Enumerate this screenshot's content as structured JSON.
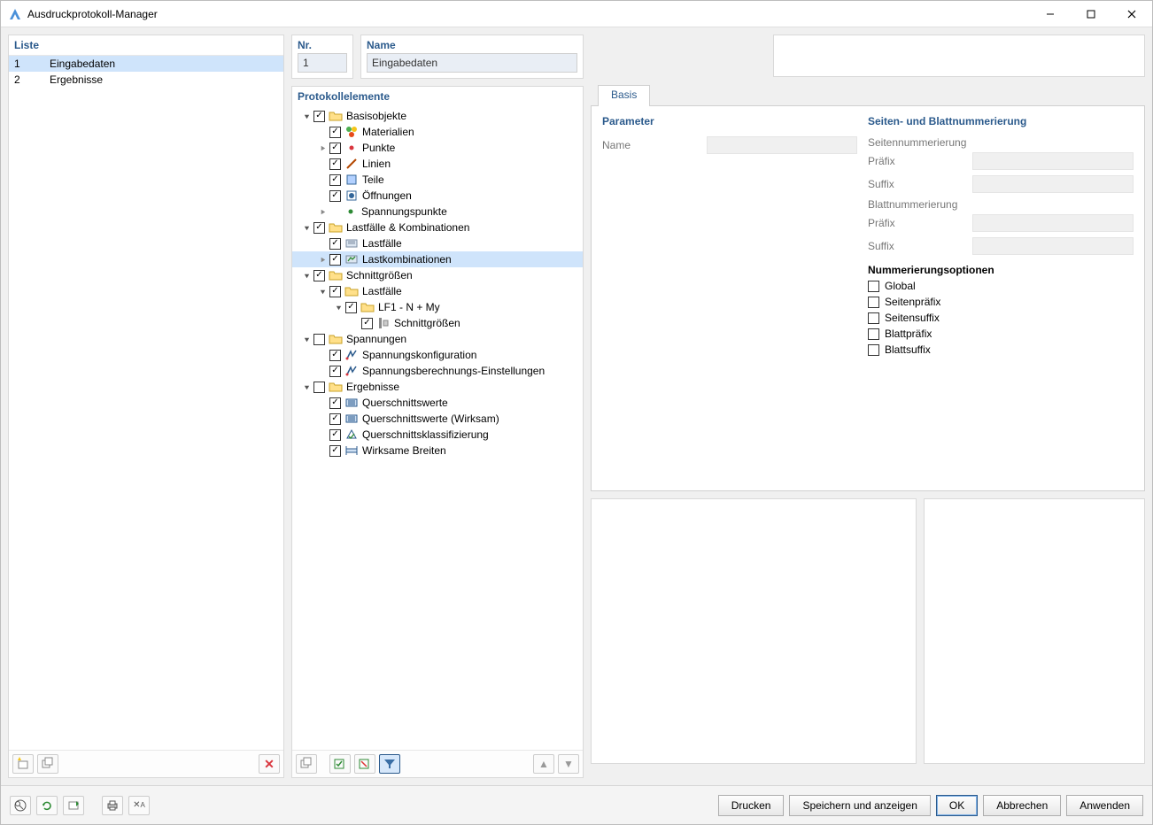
{
  "window": {
    "title": "Ausdruckprotokoll-Manager"
  },
  "left": {
    "header": "Liste",
    "rows": [
      {
        "n": "1",
        "name": "Eingabedaten",
        "selected": true
      },
      {
        "n": "2",
        "name": "Ergebnisse",
        "selected": false
      }
    ]
  },
  "mid": {
    "nr_label": "Nr.",
    "nr_value": "1",
    "name_label": "Name",
    "name_value": "Eingabedaten",
    "tree_header": "Protokollelemente",
    "tree": [
      {
        "lvl": 0,
        "expand": "open",
        "check": true,
        "icon": "folder",
        "label": "Basisobjekte"
      },
      {
        "lvl": 1,
        "expand": "none",
        "check": true,
        "icon": "materials",
        "label": "Materialien"
      },
      {
        "lvl": 1,
        "expand": "closed",
        "check": true,
        "icon": "dot-red",
        "label": "Punkte"
      },
      {
        "lvl": 1,
        "expand": "none",
        "check": true,
        "icon": "line",
        "label": "Linien"
      },
      {
        "lvl": 1,
        "expand": "none",
        "check": true,
        "icon": "part",
        "label": "Teile"
      },
      {
        "lvl": 1,
        "expand": "none",
        "check": true,
        "icon": "opening",
        "label": "Öffnungen"
      },
      {
        "lvl": 1,
        "expand": "closed",
        "check": null,
        "icon": "dot-green",
        "label": "Spannungspunkte"
      },
      {
        "lvl": 0,
        "expand": "open",
        "check": true,
        "icon": "folder",
        "label": "Lastfälle & Kombinationen"
      },
      {
        "lvl": 1,
        "expand": "none",
        "check": true,
        "icon": "lc",
        "label": "Lastfälle"
      },
      {
        "lvl": 1,
        "expand": "closed",
        "check": true,
        "icon": "lk",
        "label": "Lastkombinationen",
        "selected": true
      },
      {
        "lvl": 0,
        "expand": "open",
        "check": true,
        "icon": "folder",
        "label": "Schnittgrößen"
      },
      {
        "lvl": 1,
        "expand": "open",
        "check": true,
        "icon": "folder",
        "label": "Lastfälle"
      },
      {
        "lvl": 2,
        "expand": "open",
        "check": true,
        "icon": "folder",
        "label": "LF1 - N + My"
      },
      {
        "lvl": 3,
        "expand": "none",
        "check": true,
        "icon": "sg",
        "label": "Schnittgrößen"
      },
      {
        "lvl": 0,
        "expand": "open",
        "check": false,
        "icon": "folder",
        "label": "Spannungen"
      },
      {
        "lvl": 1,
        "expand": "none",
        "check": true,
        "icon": "sp",
        "label": "Spannungskonfiguration"
      },
      {
        "lvl": 1,
        "expand": "none",
        "check": true,
        "icon": "sp",
        "label": "Spannungsberechnungs-Einstellungen"
      },
      {
        "lvl": 0,
        "expand": "open",
        "check": false,
        "icon": "folder",
        "label": "Ergebnisse"
      },
      {
        "lvl": 1,
        "expand": "none",
        "check": true,
        "icon": "qs",
        "label": "Querschnittswerte"
      },
      {
        "lvl": 1,
        "expand": "none",
        "check": true,
        "icon": "qs",
        "label": "Querschnittswerte (Wirksam)"
      },
      {
        "lvl": 1,
        "expand": "none",
        "check": true,
        "icon": "qk",
        "label": "Querschnittsklassifizierung"
      },
      {
        "lvl": 1,
        "expand": "none",
        "check": true,
        "icon": "wb",
        "label": "Wirksame Breiten"
      }
    ]
  },
  "right": {
    "tab_basis": "Basis",
    "param_title": "Parameter",
    "param_name_label": "Name",
    "page_title": "Seiten- und Blattnummerierung",
    "seitennum": "Seitennummerierung",
    "blattnum": "Blattnummerierung",
    "prefix": "Präfix",
    "suffix": "Suffix",
    "opts_title": "Nummerierungsoptionen",
    "opts": [
      "Global",
      "Seitenpräfix",
      "Seitensuffix",
      "Blattpräfix",
      "Blattsuffix"
    ]
  },
  "footer": {
    "drucken": "Drucken",
    "speichern": "Speichern und anzeigen",
    "ok": "OK",
    "abbrechen": "Abbrechen",
    "anwenden": "Anwenden"
  }
}
